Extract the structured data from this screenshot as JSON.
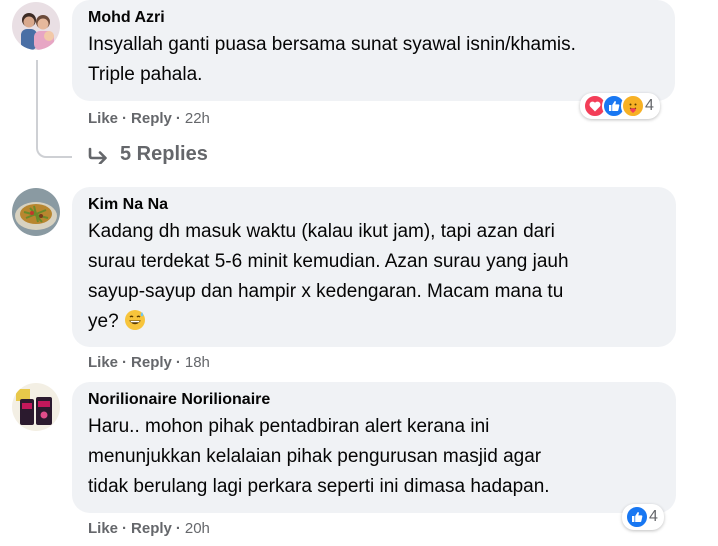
{
  "comments": [
    {
      "author": "Mohd Azri",
      "lines": [
        "Insyallah ganti puasa bersama sunat syawal isnin/khamis.",
        "Triple pahala."
      ],
      "like": "Like",
      "reply": "Reply",
      "time": "22h",
      "reactions": {
        "icons": [
          "love-icon",
          "like-icon",
          "care-icon"
        ],
        "count": "4"
      },
      "replies_label": "5 Replies"
    },
    {
      "author": "Kim Na Na",
      "lines": [
        "Kadang dh masuk waktu (kalau ikut jam), tapi azan dari",
        "surau terdekat 5-6 minit kemudian. Azan surau yang jauh",
        "sayup-sayup dan hampir x kedengaran. Macam mana tu",
        "ye?"
      ],
      "emoji": "grinning-sweat-emoji",
      "like": "Like",
      "reply": "Reply",
      "time": "18h"
    },
    {
      "author": "Norilionaire Norilionaire",
      "lines": [
        "Haru.. mohon pihak pentadbiran alert kerana ini",
        "menunjukkan kelalaian pihak pengurusan masjid agar",
        "tidak berulang lagi perkara seperti ini dimasa hadapan."
      ],
      "like": "Like",
      "reply": "Reply",
      "time": "20h",
      "reactions": {
        "icons": [
          "like-icon"
        ],
        "count": "4"
      }
    }
  ],
  "colors": {
    "bubble": "#f0f2f5",
    "meta": "#65676b",
    "like_blue": "#1877f2",
    "love_red": "#f33e58",
    "care_yellow": "#f7b125"
  }
}
